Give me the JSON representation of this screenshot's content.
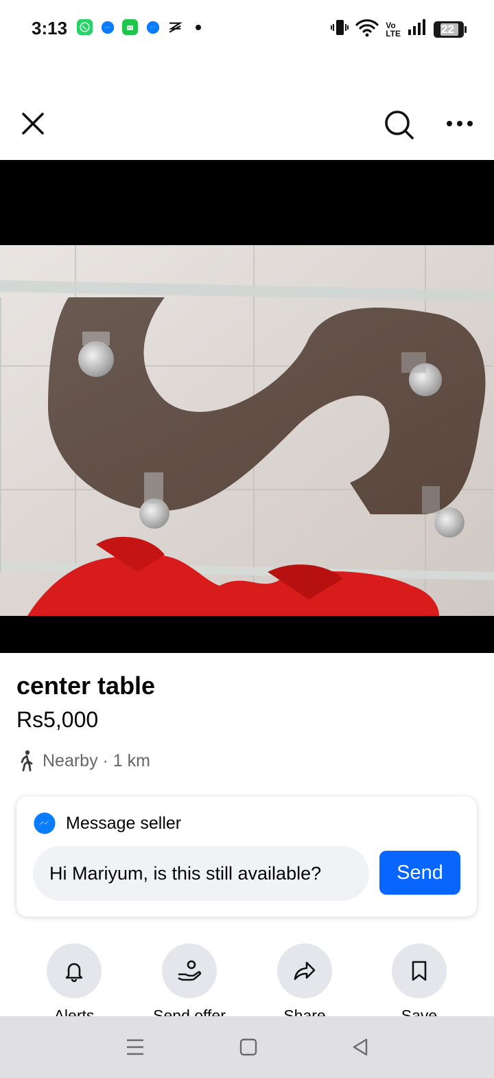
{
  "status_bar": {
    "time": "3:13",
    "notification_icons": [
      "whatsapp-icon",
      "messenger-icon",
      "green-app-icon",
      "messenger-icon",
      "capcut-icon",
      "dot-icon"
    ],
    "system_icons": [
      "vibrate-icon",
      "wifi-icon",
      "volte-icon",
      "signal-icon",
      "battery-icon"
    ],
    "volte_label_top": "Vo",
    "volte_label_bottom": "LTE",
    "battery_level": "22"
  },
  "top_nav": {
    "close_icon": "close-icon",
    "search_icon": "search-icon",
    "more_icon": "more-horizontal-icon"
  },
  "listing": {
    "title": "center table",
    "price": "Rs5,000",
    "location": "Nearby · 1 km",
    "location_icon": "walking-person-icon"
  },
  "message_seller": {
    "header": "Message seller",
    "input_value": "Hi Mariyum, is this still available?",
    "send_label": "Send"
  },
  "actions": [
    {
      "label": "Alerts",
      "icon": "bell-icon"
    },
    {
      "label": "Send offer",
      "icon": "offer-hand-icon"
    },
    {
      "label": "Share",
      "icon": "share-icon"
    },
    {
      "label": "Save",
      "icon": "bookmark-icon"
    }
  ],
  "colors": {
    "accent": "#0866ff",
    "secondary_text": "#65676b",
    "chip_bg": "#e4e6eb",
    "input_bg": "#f0f2f5",
    "nav_bar_bg": "#e0e0e3"
  }
}
